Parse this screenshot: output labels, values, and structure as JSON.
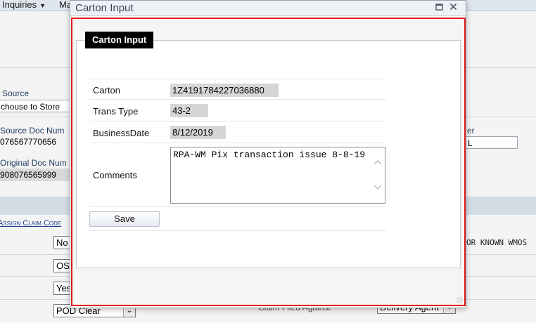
{
  "background": {
    "menus": [
      {
        "label": "Inquiries"
      },
      {
        "label": "Ma"
      }
    ],
    "fields": {
      "source_label": "Source",
      "source_value": "chouse to Store",
      "source_doc_num_label": "Source Doc Num",
      "source_doc_num_value": "076567770656",
      "original_doc_num_label": "Original Doc Num",
      "original_doc_num_value": "908076565999",
      "right_label_fragment": "er",
      "right_value_fragment": "L"
    },
    "assign_claim_code_link": "Assign Claim Code",
    "right_mono_text": "OR KNOWN WMOS",
    "selects": [
      {
        "value": "No"
      },
      {
        "value": "OS"
      },
      {
        "value": "Yes"
      },
      {
        "value": "POD Clear"
      }
    ],
    "claim_filed_against_label": "Claim Filed Against",
    "claim_filed_against_value": "Delivery Agent"
  },
  "dialog": {
    "title": "Carton Input",
    "maximize_icon": "maximize-icon",
    "close_icon": "close-icon",
    "legend": "Carton Input",
    "rows": {
      "carton": {
        "label": "Carton",
        "value": "1Z4191784227036880"
      },
      "trans_type": {
        "label": "Trans Type",
        "value": "43-2"
      },
      "business_date": {
        "label": "BusinessDate",
        "value": "8/12/2019"
      },
      "comments": {
        "label": "Comments",
        "value": "RPA-WM Pix transaction issue 8-8-19"
      }
    },
    "save_label": "Save",
    "highlight_color": "#e01b1b"
  }
}
